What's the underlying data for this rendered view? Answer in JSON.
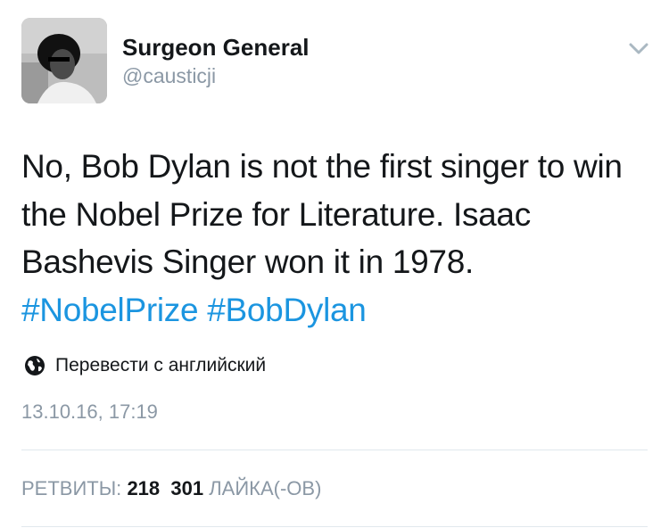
{
  "user": {
    "name": "Surgeon General",
    "handle": "@causticji"
  },
  "tweet": {
    "text": "No, Bob Dylan is not the first singer to win the Nobel Prize for Literature. Isaac Bashevis Singer won it in 1978.",
    "hashtags": [
      "#NobelPrize",
      "#BobDylan"
    ],
    "hashtag_color": "#1b95e0"
  },
  "translate": {
    "icon": "globe-icon",
    "label": "Перевести с английский"
  },
  "timestamp": "13.10.16, 17:19",
  "stats": {
    "retweets_label": "РЕТВИТЫ:",
    "retweets_count": "218",
    "likes_count": "301",
    "likes_label": "ЛАЙКА(-ОВ)"
  },
  "colors": {
    "text": "#14171a",
    "secondary": "#8b98a5",
    "divider": "#e1e8ed"
  }
}
